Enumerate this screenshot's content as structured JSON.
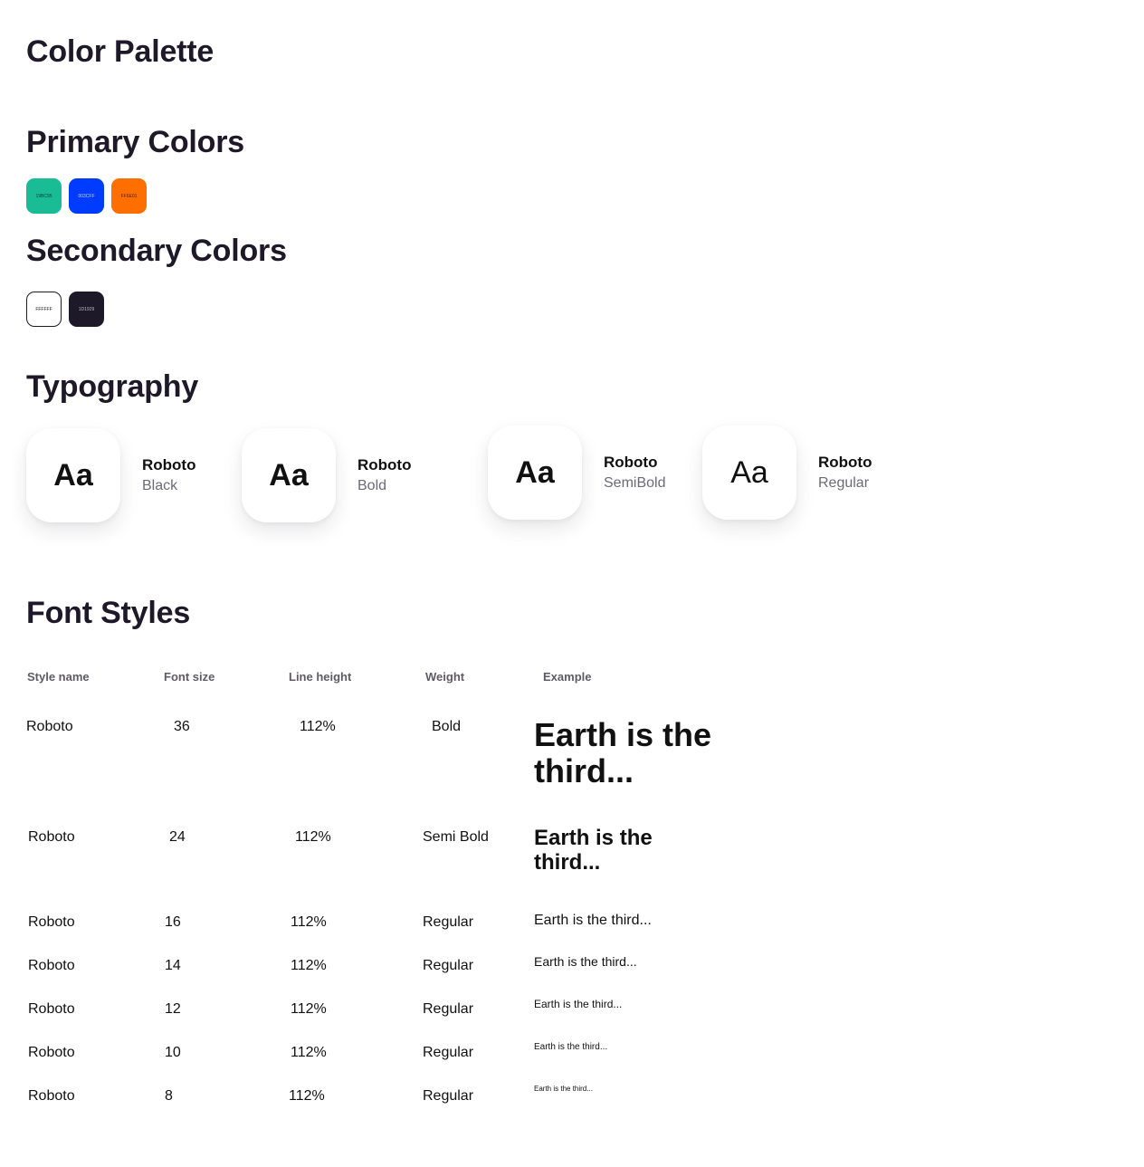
{
  "page_title": "Color Palette",
  "primary": {
    "heading": "Primary Colors",
    "swatches": [
      {
        "hex": "19BC95",
        "color": "#19BC95",
        "text_color": "#0f3d33"
      },
      {
        "hex": "003CFF",
        "color": "#003CFF",
        "text_color": "#c8d4ff"
      },
      {
        "hex": "FF6E01",
        "color": "#FF6E01",
        "text_color": "#4a1f00"
      }
    ]
  },
  "secondary": {
    "heading": "Secondary Colors",
    "swatches": [
      {
        "hex": "FFFFFF",
        "color": "#FFFFFF",
        "text_color": "#1D1929"
      },
      {
        "hex": "1D1929",
        "color": "#1D1929",
        "text_color": "#bdbbc6"
      }
    ]
  },
  "typography": {
    "heading": "Typography",
    "cards": [
      {
        "sample": "Aa",
        "family": "Roboto",
        "weight": "Black"
      },
      {
        "sample": "Aa",
        "family": "Roboto",
        "weight": "Bold"
      },
      {
        "sample": "Aa",
        "family": "Roboto",
        "weight": "SemiBold"
      },
      {
        "sample": "Aa",
        "family": "Roboto",
        "weight": "Regular"
      }
    ]
  },
  "font_styles": {
    "heading": "Font Styles",
    "columns": [
      "Style name",
      "Font size",
      "Line height",
      "Weight",
      "Example"
    ],
    "rows": [
      {
        "name": "Roboto",
        "size": "36",
        "line_height": "112%",
        "weight": "Bold",
        "example": "Earth is the third..."
      },
      {
        "name": "Roboto",
        "size": "24",
        "line_height": "112%",
        "weight": "Semi Bold",
        "example": "Earth is the third..."
      },
      {
        "name": "Roboto",
        "size": "16",
        "line_height": "112%",
        "weight": "Regular",
        "example": "Earth is the third..."
      },
      {
        "name": "Roboto",
        "size": "14",
        "line_height": "112%",
        "weight": "Regular",
        "example": "Earth is the third..."
      },
      {
        "name": "Roboto",
        "size": "12",
        "line_height": "112%",
        "weight": "Regular",
        "example": "Earth is the third..."
      },
      {
        "name": "Roboto",
        "size": "10",
        "line_height": "112%",
        "weight": "Regular",
        "example": "Earth is the third..."
      },
      {
        "name": "Roboto",
        "size": "8",
        "line_height": "112%",
        "weight": "Regular",
        "example": "Earth is the third..."
      }
    ]
  }
}
